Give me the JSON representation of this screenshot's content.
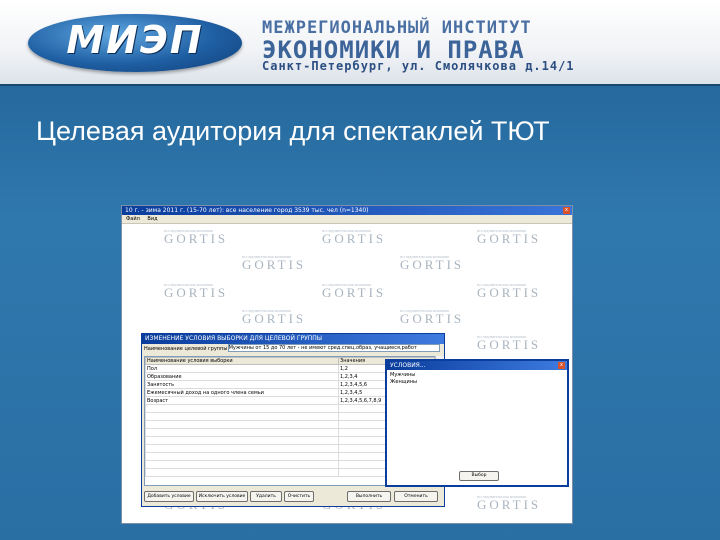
{
  "header": {
    "logo": "МИЭП",
    "institute_line1": "МЕЖРЕГИОНАЛЬНЫЙ ИНСТИТУТ",
    "institute_line2": "ЭКОНОМИКИ И ПРАВА",
    "institute_line3": "Санкт-Петербург, ул. Смолячкова д.14/1"
  },
  "slide": {
    "title": "Целевая аудитория для спектаклей ТЮТ"
  },
  "app": {
    "title": "10 г. - зима 2011 г. (15-70 лет): все население город 3539 тыс. чел (n=1340)",
    "close": "x",
    "menu": [
      "Файл",
      "Вид"
    ],
    "watermark_small": "исследовательская компания",
    "watermark": "GORTIS"
  },
  "dialog": {
    "title": "ИЗМЕНЕНИЕ УСЛОВИЯ ВЫБОРКИ ДЛЯ ЦЕЛЕВОЙ ГРУППЫ",
    "name_label": "Наименование целевой группы",
    "name_value": "Мужчины от 15 до 70 лет - не имеют сред.спец.образ, учащиеся,работ",
    "columns": [
      "Наименование условия выборки",
      "Значения"
    ],
    "rows": [
      {
        "cond": "Пол",
        "val": "1,2"
      },
      {
        "cond": "Образование",
        "val": "1,2,3,4"
      },
      {
        "cond": "Занятость",
        "val": "1,2,3,4,5,6"
      },
      {
        "cond": "Ежемесячный доход на одного члена семьи",
        "val": "1,2,3,4,5"
      },
      {
        "cond": "Возраст",
        "val": "1,2,3,4,5,6,7,8,9"
      }
    ],
    "buttons": [
      "Добавить условие",
      "Исключить условие",
      "Удалить",
      "Очистить",
      "Выполнить",
      "Отменить"
    ]
  },
  "conditions": {
    "title": "УСЛОВИЯ...",
    "close": "x",
    "items": [
      "Мужчины",
      "Женщины"
    ],
    "button": "Выбор"
  }
}
